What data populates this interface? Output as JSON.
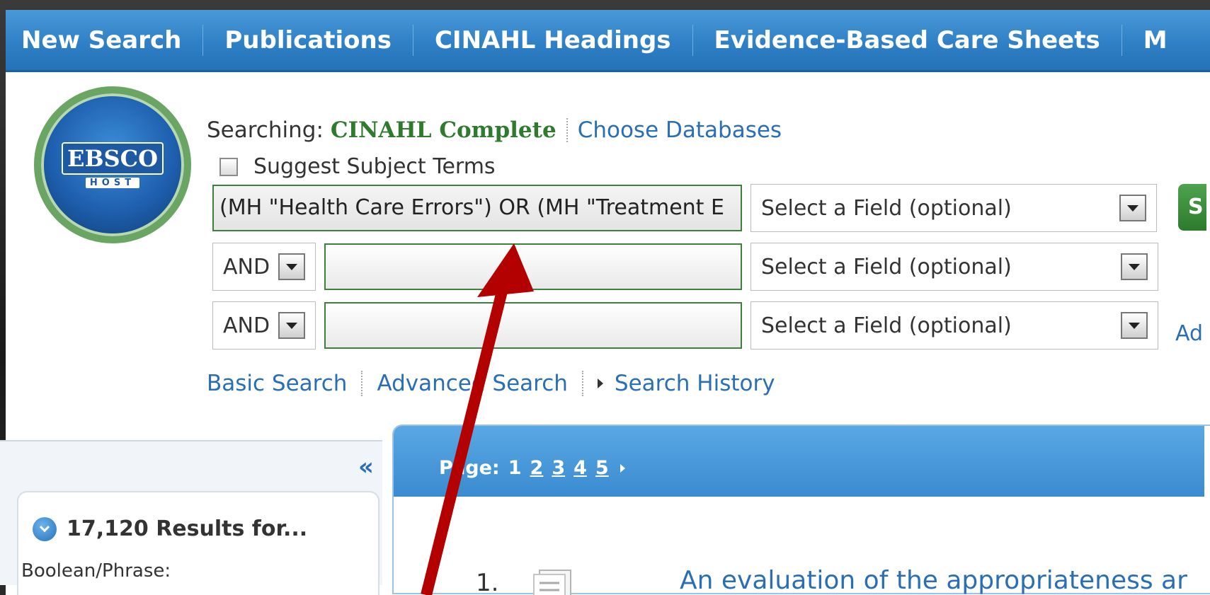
{
  "nav": {
    "items": [
      "New Search",
      "Publications",
      "CINAHL Headings",
      "Evidence-Based Care Sheets",
      "M"
    ]
  },
  "logo": {
    "word": "EBSCO",
    "sub": "HOST"
  },
  "searching": {
    "label": "Searching:",
    "database": "CINAHL Complete",
    "choose": "Choose Databases"
  },
  "suggest": {
    "label": "Suggest Subject Terms",
    "checked": false
  },
  "search": {
    "query": "(MH \"Health Care Errors\") OR (MH \"Treatment E",
    "row_operators": [
      "AND",
      "AND"
    ],
    "field_placeholder": "Select a Field (optional)",
    "go_label": "S",
    "add_label": "Ad"
  },
  "links": {
    "basic": "Basic Search",
    "advanced": "Advanced Search",
    "history": "Search History"
  },
  "left": {
    "collapse": "«",
    "results_count": "17,120 Results for...",
    "boolean_label": "Boolean/Phrase:"
  },
  "pager": {
    "label": "Page:",
    "current": "1",
    "pages": [
      "2",
      "3",
      "4",
      "5"
    ]
  },
  "result": {
    "number": "1.",
    "title": "An evaluation of the appropriateness ar"
  },
  "colors": {
    "nav_bg": "#2f80c6",
    "database_green": "#2f7a2f",
    "link_blue": "#2a6fb5",
    "annotation_red": "#b30000"
  }
}
